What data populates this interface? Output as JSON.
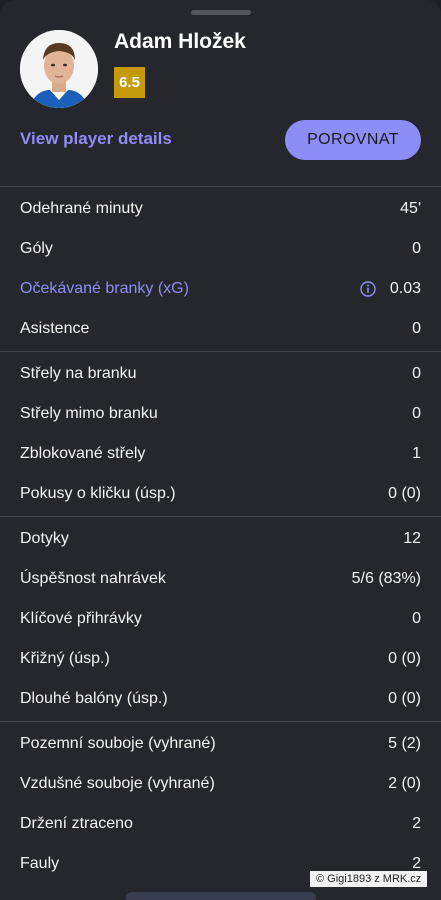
{
  "player": {
    "name": "Adam Hložek",
    "rating": "6.5",
    "details_link": "View player details",
    "compare_button": "POROVNAT"
  },
  "stat_groups": [
    [
      {
        "label": "Odehrané minuty",
        "value": "45'"
      },
      {
        "label": "Góly",
        "value": "0"
      },
      {
        "label": "Očekávané branky (xG)",
        "value": "0.03",
        "link": true,
        "info_icon": true
      },
      {
        "label": "Asistence",
        "value": "0"
      }
    ],
    [
      {
        "label": "Střely na branku",
        "value": "0"
      },
      {
        "label": "Střely mimo branku",
        "value": "0"
      },
      {
        "label": "Zblokované střely",
        "value": "1"
      },
      {
        "label": "Pokusy o kličku (úsp.)",
        "value": "0 (0)"
      }
    ],
    [
      {
        "label": "Dotyky",
        "value": "12"
      },
      {
        "label": "Úspěšnost nahrávek",
        "value": "5/6 (83%)"
      },
      {
        "label": "Klíčové přihrávky",
        "value": "0"
      },
      {
        "label": "Křižný (úsp.)",
        "value": "0 (0)"
      },
      {
        "label": "Dlouhé balóny (úsp.)",
        "value": "0 (0)"
      }
    ],
    [
      {
        "label": "Pozemní souboje (vyhrané)",
        "value": "5 (2)"
      },
      {
        "label": "Vzdušné souboje (vyhrané)",
        "value": "2 (0)"
      },
      {
        "label": "Držení ztraceno",
        "value": "2"
      },
      {
        "label": "Fauly",
        "value": "2"
      }
    ]
  ],
  "watermark": "© Gigi1893 z MRK.cz",
  "colors": {
    "background": "#25272d",
    "accent": "#8c8ef5",
    "rating_badge": "#c49a0b",
    "separator": "#45474d"
  }
}
